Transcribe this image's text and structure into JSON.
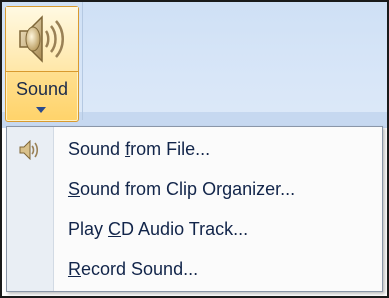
{
  "ribbon": {
    "sound_button": {
      "label": "Sound",
      "icon": "speaker-icon"
    }
  },
  "menu": {
    "items": [
      {
        "label_pre": "Sound ",
        "access_key": "f",
        "label_post": "rom File...",
        "icon": "speaker-icon"
      },
      {
        "label_pre": "",
        "access_key": "S",
        "label_post": "ound from Clip Organizer..."
      },
      {
        "label_pre": "Play ",
        "access_key": "C",
        "label_post": "D Audio Track..."
      },
      {
        "label_pre": "",
        "access_key": "R",
        "label_post": "ecord Sound..."
      }
    ]
  },
  "colors": {
    "ribbon_bg": "#d8e6f8",
    "button_highlight": "#ffd36a",
    "menu_text": "#12254a"
  }
}
